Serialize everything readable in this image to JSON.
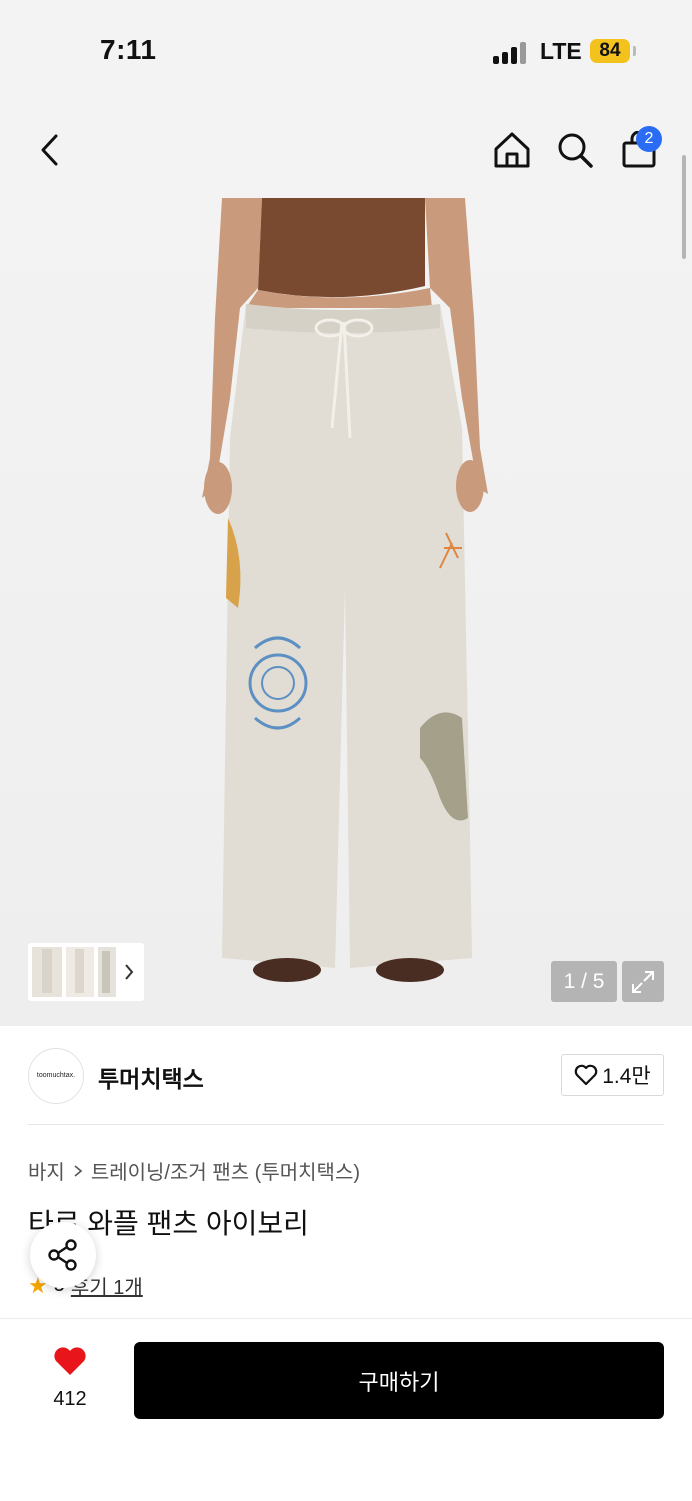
{
  "status": {
    "time": "7:11",
    "carrier": "LTE",
    "battery": "84"
  },
  "nav": {
    "cart_count": "2"
  },
  "gallery": {
    "counter": "1 / 5",
    "thumbnail_count": 3
  },
  "brand": {
    "logo_text": "toomuchtax.",
    "name": "투머치택스",
    "likes": "1.4만"
  },
  "breadcrumb": {
    "category": "바지",
    "subcategory": "트레이닝/조거 팬츠 (투머치택스)"
  },
  "product": {
    "title": "타로 와플 팬츠 아이보리",
    "rating": "5",
    "reviews": "후기 1개"
  },
  "bottom": {
    "wish_count": "412",
    "buy_label": "구매하기"
  },
  "colors": {
    "accent_badge": "#2a6df4",
    "heart": "#e8161b",
    "battery": "#f4c21c",
    "buy_button": "#000000"
  }
}
